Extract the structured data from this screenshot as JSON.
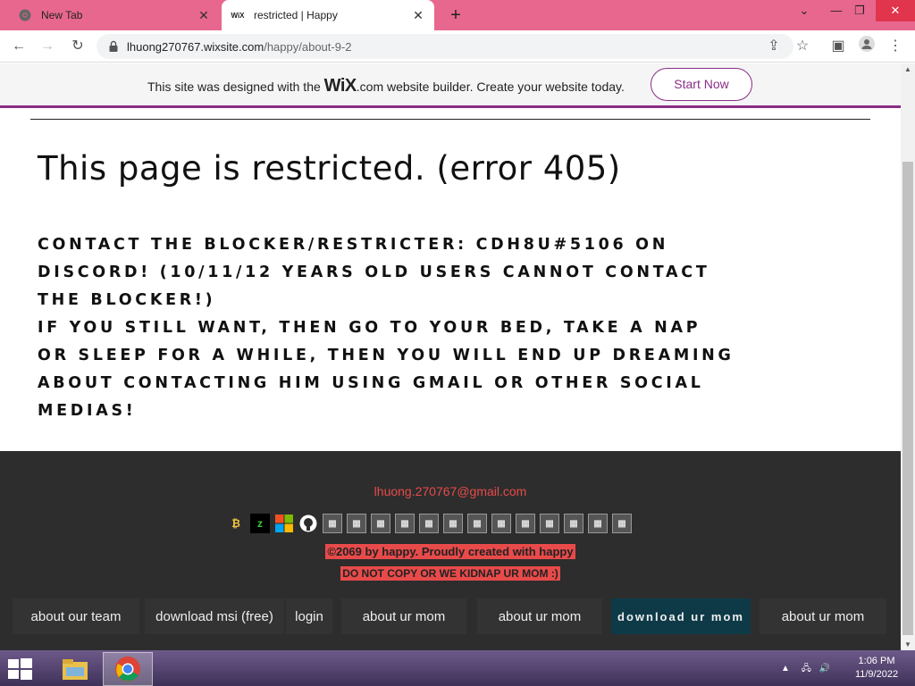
{
  "browser": {
    "tabs": [
      {
        "title": "New Tab",
        "favicon": "chrome-icon"
      },
      {
        "title": "restricted | Happy",
        "favicon": "wix-icon",
        "active": true
      }
    ],
    "url_host": "lhuong270767.wixsite.com",
    "url_path": "/happy/about-9-2"
  },
  "wix_banner": {
    "text_before": "This site was designed with the ",
    "logo": "WiX",
    "text_after": ".com website builder. Create your website today.",
    "button": "Start Now",
    "accent": "#8a2e87"
  },
  "page": {
    "headline": "This page is restricted. (error 405)",
    "paragraphs": [
      "Contact the blocker/restricter: cdh8u#5106 on Discord! (10/11/12 years old users cannot contact the blocker!)",
      "If you still want, then go to your bed, take a nap or sleep for a while, then you will end up dreaming about contacting him using Gmail or other social medias!"
    ]
  },
  "footer": {
    "email": "lhuong.270767@gmail.com",
    "copyright": "©2069 by happy. Proudly created with happy",
    "warning": "DO NOT COPY OR WE KIDNAP UR MOM :)",
    "accent": "#e84a4a",
    "menu": [
      "about our team",
      "download msi (free)",
      "login",
      "about ur mom",
      "about ur mom",
      "download ur mom",
      "about ur mom"
    ]
  },
  "taskbar": {
    "time": "1:06 PM",
    "date": "11/9/2022"
  }
}
